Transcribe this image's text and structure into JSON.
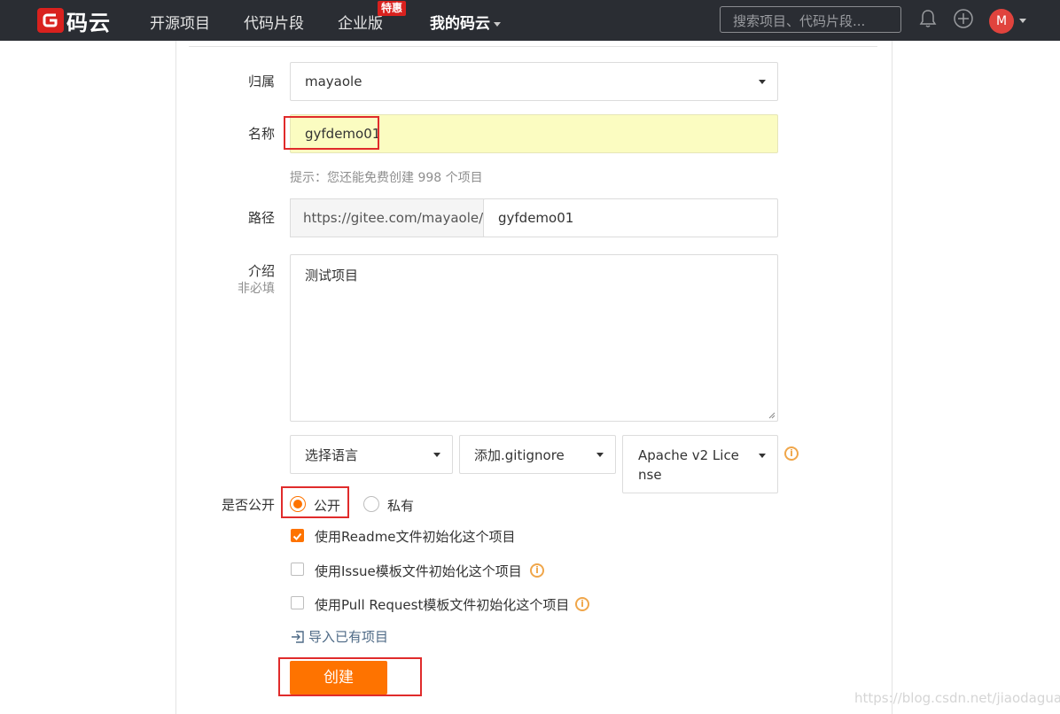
{
  "nav": {
    "logo_text": "码云",
    "items": [
      {
        "label": "开源项目"
      },
      {
        "label": "代码片段"
      },
      {
        "label": "企业版"
      },
      {
        "label": "我的码云"
      }
    ],
    "badge": "特惠",
    "search_placeholder": "搜索项目、代码片段...",
    "avatar_letter": "M",
    "brand_color": "#d9211e",
    "bg_color": "#2a2d33"
  },
  "form": {
    "owner": {
      "label": "归属",
      "value": "mayaole"
    },
    "name": {
      "label": "名称",
      "value": "gyfdemo01"
    },
    "hint": "提示：您还能免费创建 998 个项目",
    "path": {
      "label": "路径",
      "prefix": "https://gitee.com/mayaole/",
      "value": "gyfdemo01"
    },
    "intro": {
      "label": "介绍",
      "sublabel": "非必填",
      "value": "测试项目"
    },
    "language": {
      "value": "选择语言"
    },
    "gitignore": {
      "value": "添加.gitignore"
    },
    "license": {
      "value": "Apache v2 License"
    },
    "visibility": {
      "label": "是否公开",
      "options": [
        "公开",
        "私有"
      ],
      "selected": "公开"
    },
    "checkboxes": [
      {
        "label": "使用Readme文件初始化这个项目",
        "checked": true
      },
      {
        "label": "使用Issue模板文件初始化这个项目",
        "checked": false
      },
      {
        "label": "使用Pull Request模板文件初始化这个项目",
        "checked": false
      }
    ],
    "import_link": "导入已有项目",
    "submit": "创建",
    "accent_color": "#fe7300"
  },
  "watermark": "https://blog.csdn.net/jiaodaguan"
}
